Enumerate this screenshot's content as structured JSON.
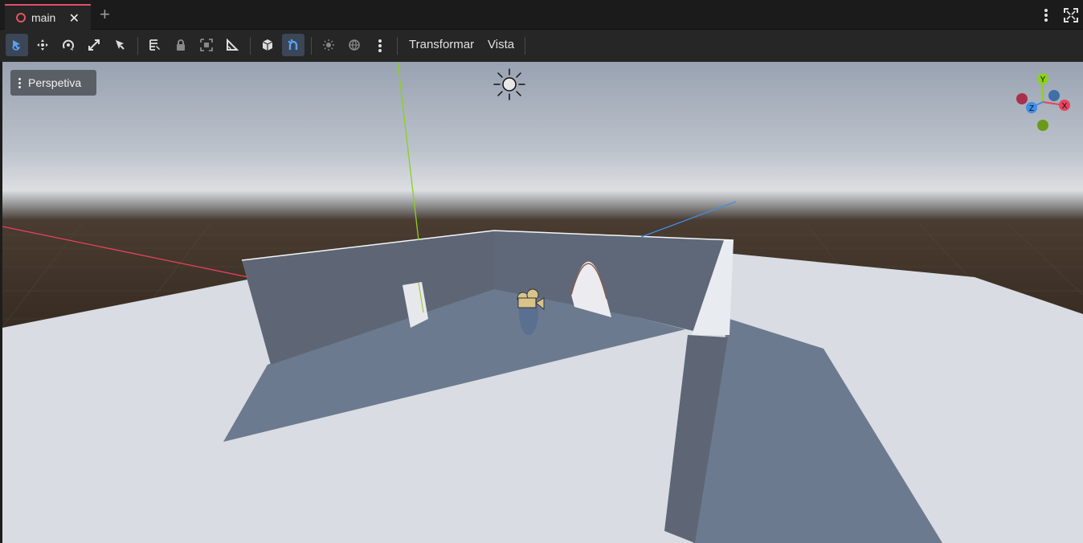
{
  "tabs": [
    {
      "label": "main",
      "icon": "scene-circle-icon",
      "active": true
    }
  ],
  "toolbar": {
    "tools": [
      {
        "name": "select-mode",
        "icon": "select-arrow-icon",
        "active": true
      },
      {
        "name": "move-mode",
        "icon": "move-icon"
      },
      {
        "name": "rotate-mode",
        "icon": "rotate-icon"
      },
      {
        "name": "scale-mode",
        "icon": "scale-icon"
      },
      {
        "name": "list-select",
        "icon": "pointer-icon"
      },
      {
        "name": "ruler-mode",
        "icon": "ruler-icon"
      },
      {
        "name": "lock",
        "icon": "lock-icon"
      },
      {
        "name": "group",
        "icon": "group-icon"
      },
      {
        "name": "snap-angle",
        "icon": "angle-icon"
      },
      {
        "name": "local-space",
        "icon": "cube-icon"
      },
      {
        "name": "use-snap",
        "icon": "snap-magnet-icon",
        "active": true
      },
      {
        "name": "preview-sun",
        "icon": "sun-icon"
      },
      {
        "name": "preview-environment",
        "icon": "globe-icon"
      }
    ],
    "menus": {
      "transform": "Transformar",
      "view": "Vista"
    }
  },
  "viewport": {
    "perspective_label": "Perspetiva",
    "gizmo": {
      "x": "X",
      "y": "Y",
      "z": "Z"
    },
    "colors": {
      "x_axis": "#e8425e",
      "y_axis": "#8ad11e",
      "z_axis": "#3f8ee8",
      "sky_top": "#9aa4b3",
      "ground": "#d9dde4"
    }
  }
}
